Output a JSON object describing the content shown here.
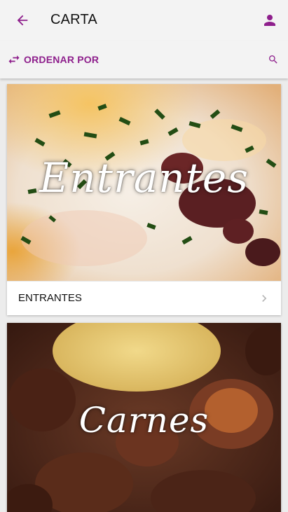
{
  "header": {
    "title": "CARTA",
    "back_icon": "arrow-left-icon",
    "account_icon": "person-icon"
  },
  "toolbar": {
    "sort_label": "ORDENAR POR",
    "sort_icon": "swap-horizontal-icon",
    "search_icon": "search-icon"
  },
  "colors": {
    "accent": "#8e1f8c",
    "app_bar": "#f3f3f3",
    "background": "#ececec"
  },
  "categories": [
    {
      "label": "ENTRANTES",
      "image_caption": "Entrantes"
    },
    {
      "label": "",
      "image_caption": "Carnes"
    }
  ]
}
